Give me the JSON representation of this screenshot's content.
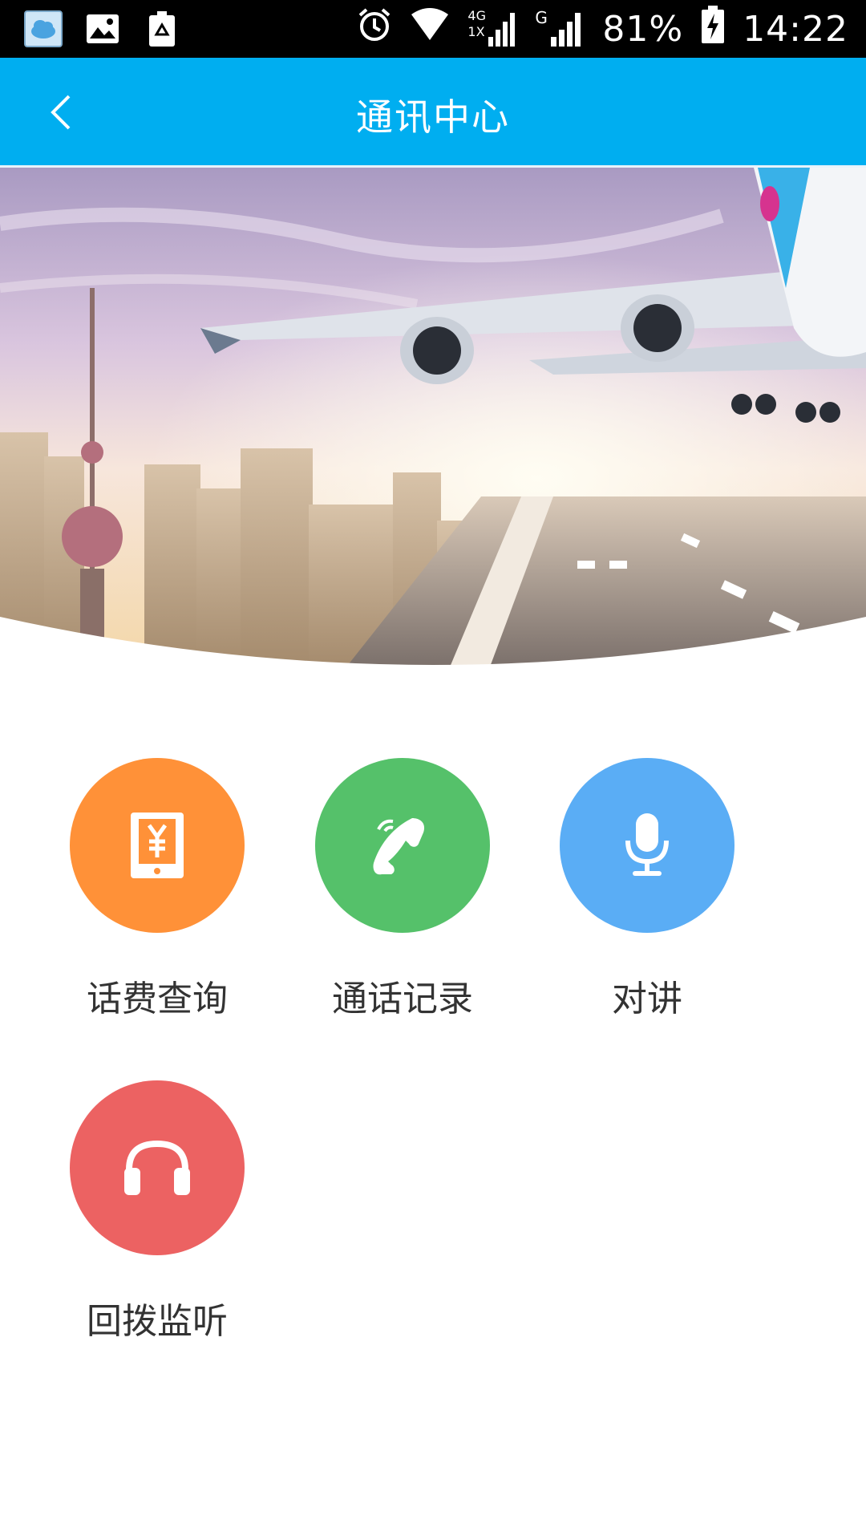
{
  "status_bar": {
    "battery": "81%",
    "time": "14:22",
    "network_4g": "4G",
    "network_1x": "1X",
    "network_g": "G"
  },
  "header": {
    "title": "通讯中心"
  },
  "colors": {
    "header_bg": "#00aef0",
    "orange": "#ff9138",
    "green": "#55c16a",
    "blue": "#5aadf5",
    "red": "#ec6262"
  },
  "menu": [
    {
      "label": "话费查询",
      "icon": "bill-icon",
      "color": "#ff9138"
    },
    {
      "label": "通话记录",
      "icon": "phone-icon",
      "color": "#55c16a"
    },
    {
      "label": "对讲",
      "icon": "microphone-icon",
      "color": "#5aadf5"
    },
    {
      "label": "回拨监听",
      "icon": "headphones-icon",
      "color": "#ec6262"
    }
  ]
}
